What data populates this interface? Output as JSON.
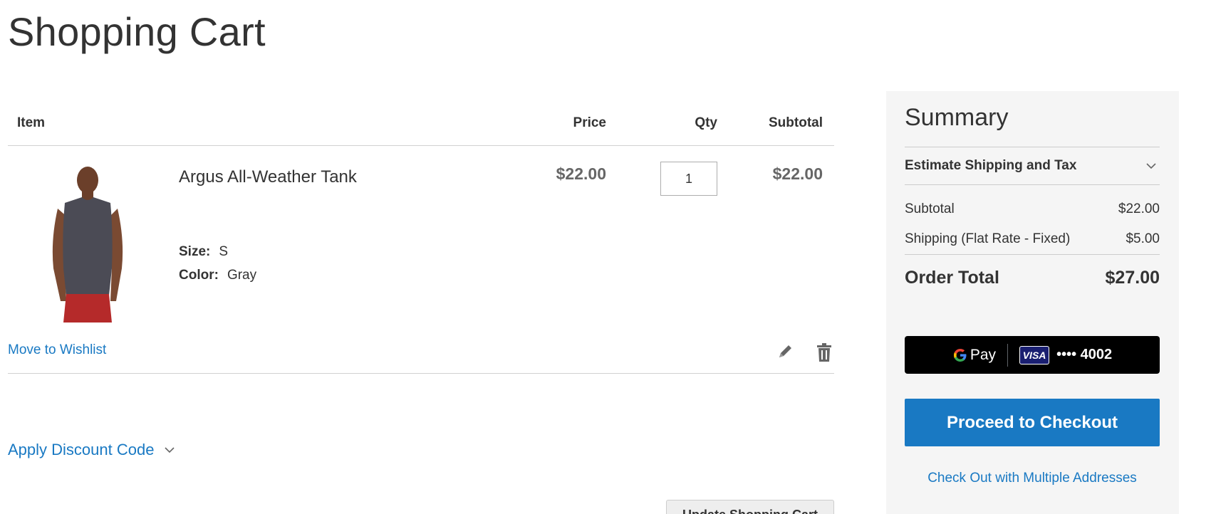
{
  "page": {
    "title": "Shopping Cart"
  },
  "cart": {
    "columns": {
      "item": "Item",
      "price": "Price",
      "qty": "Qty",
      "subtotal": "Subtotal"
    },
    "items": [
      {
        "name": "Argus All-Weather Tank",
        "options": [
          {
            "label": "Size:",
            "value": "S"
          },
          {
            "label": "Color:",
            "value": "Gray"
          }
        ],
        "price": "$22.00",
        "qty": "1",
        "subtotal": "$22.00",
        "wishlist_label": "Move to Wishlist"
      }
    ],
    "update_label": "Update Shopping Cart",
    "discount_label": "Apply Discount Code"
  },
  "summary": {
    "title": "Summary",
    "estimate_label": "Estimate Shipping and Tax",
    "subtotal_label": "Subtotal",
    "subtotal_value": "$22.00",
    "shipping_label": "Shipping (Flat Rate - Fixed)",
    "shipping_value": "$5.00",
    "total_label": "Order Total",
    "total_value": "$27.00",
    "gpay": {
      "pay_label": "Pay",
      "card_brand": "VISA",
      "card_mask": "•••• 4002"
    },
    "checkout_label": "Proceed to Checkout",
    "multi_label": "Check Out with Multiple Addresses"
  },
  "colors": {
    "link": "#1979c3",
    "primary_button": "#1979c3",
    "summary_bg": "#f5f5f5",
    "gpay_bg": "#000000",
    "visa_blue": "#1a1f71"
  },
  "icons": {
    "edit": "pencil-icon",
    "delete": "trash-icon",
    "expand": "chevron-down-icon",
    "google": "google-g-icon"
  }
}
